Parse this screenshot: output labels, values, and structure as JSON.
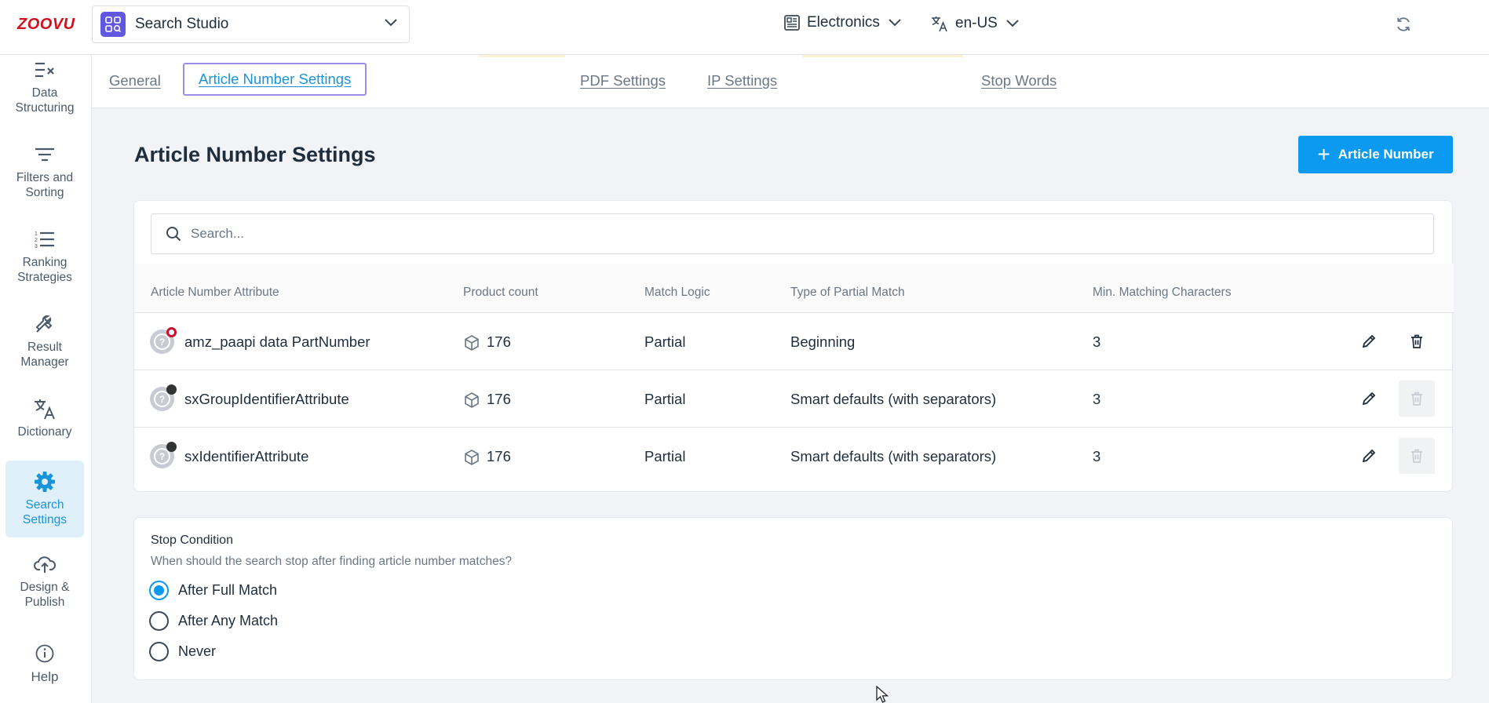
{
  "header": {
    "logo": "ZOOVU",
    "app_name": "Search Studio",
    "catalog": "Electronics",
    "locale": "en-US"
  },
  "sidebar": {
    "items": [
      {
        "label": "Data Structuring"
      },
      {
        "label": "Filters and Sorting"
      },
      {
        "label": "Ranking Strategies"
      },
      {
        "label": "Result Manager"
      },
      {
        "label": "Dictionary"
      },
      {
        "label": "Search Settings"
      },
      {
        "label": "Design & Publish"
      },
      {
        "label": "Help"
      }
    ]
  },
  "tabs": [
    "General",
    "Article Number Settings",
    "PDF Settings",
    "IP Settings",
    "Stop Words"
  ],
  "page": {
    "title": "Article Number Settings",
    "add_button": "Article Number"
  },
  "search": {
    "placeholder": "Search..."
  },
  "table": {
    "columns": [
      "Article Number Attribute",
      "Product count",
      "Match Logic",
      "Type of Partial Match",
      "Min. Matching Characters"
    ],
    "rows": [
      {
        "attribute": "amz_paapi data PartNumber",
        "count": "176",
        "logic": "Partial",
        "type": "Beginning",
        "min": "3"
      },
      {
        "attribute": "sxGroupIdentifierAttribute",
        "count": "176",
        "logic": "Partial",
        "type": "Smart defaults (with separators)",
        "min": "3"
      },
      {
        "attribute": "sxIdentifierAttribute",
        "count": "176",
        "logic": "Partial",
        "type": "Smart defaults (with separators)",
        "min": "3"
      }
    ]
  },
  "stop_condition": {
    "title": "Stop Condition",
    "subtitle": "When should the search stop after finding article number matches?",
    "options": [
      "After Full Match",
      "After Any Match",
      "Never"
    ],
    "selected": "After Full Match"
  },
  "colors": {
    "accent": "#0b9af0",
    "brand": "#d0121e",
    "app_icon": "#6257e0"
  }
}
